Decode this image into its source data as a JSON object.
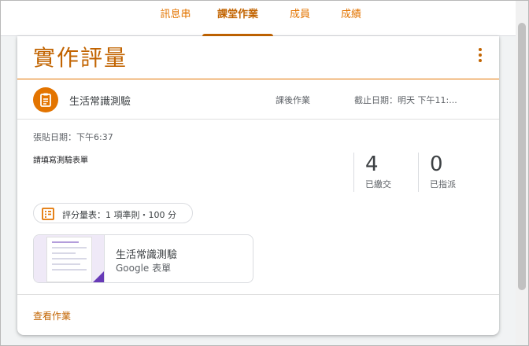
{
  "nav": {
    "tabs": [
      {
        "label": "訊息串",
        "active": false
      },
      {
        "label": "課堂作業",
        "active": true
      },
      {
        "label": "成員",
        "active": false
      },
      {
        "label": "成績",
        "active": false
      }
    ]
  },
  "topic": {
    "title": "實作評量"
  },
  "assignment": {
    "title": "生活常識測驗",
    "topic_label": "課後作業",
    "due": "截止日期：明天 下午11:...",
    "posted": "張貼日期：下午6:37",
    "instructions": "請填寫測驗表單",
    "stats": {
      "turned_in_count": "4",
      "turned_in_label": "已繳交",
      "assigned_count": "0",
      "assigned_label": "已指派"
    },
    "rubric": "評分量表：1 項準則・100 分",
    "attachment": {
      "title": "生活常識測驗",
      "subtitle": "Google 表單"
    },
    "view_link": "查看作業"
  },
  "colors": {
    "accent": "#e37400",
    "accent_dark": "#c26401",
    "forms_purple": "#673ab7"
  },
  "icons": {
    "assignment": "assignment-icon",
    "more": "more-vert-icon",
    "rubric": "rubric-icon"
  }
}
